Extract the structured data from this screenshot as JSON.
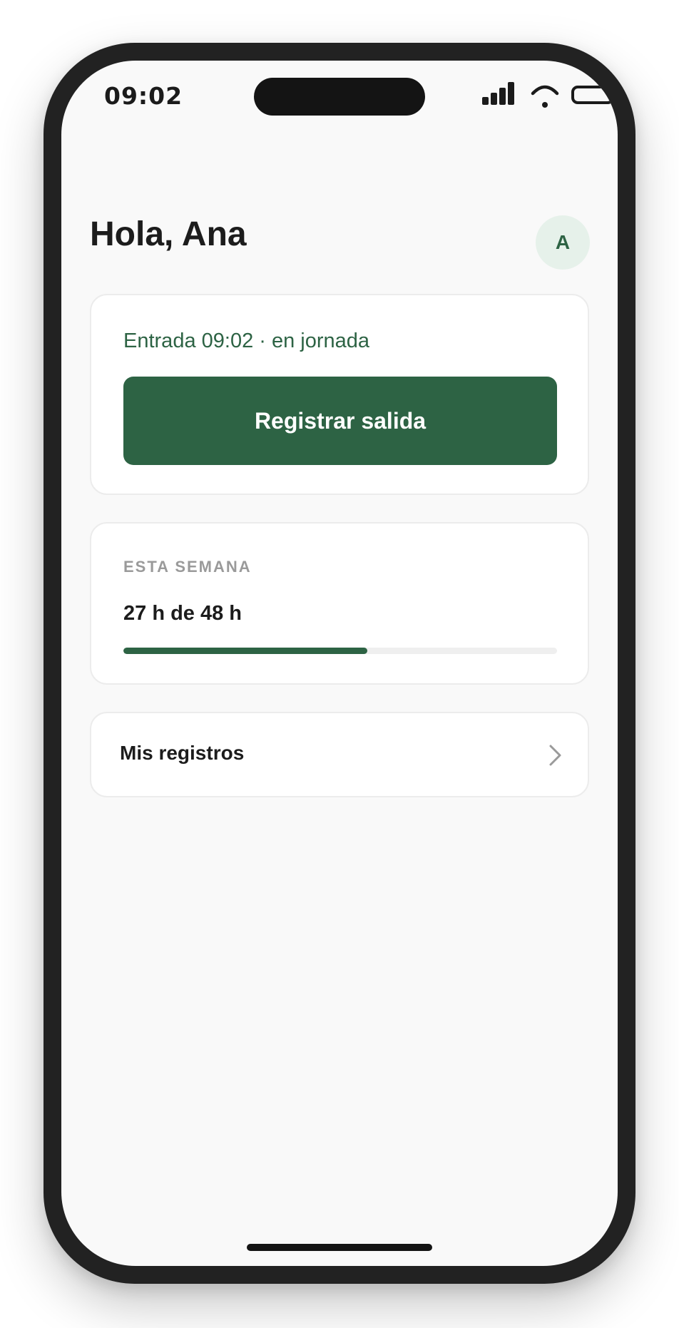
{
  "status_bar": {
    "time": "09:02",
    "icons": [
      "signal-icon",
      "wifi-icon",
      "battery-icon"
    ]
  },
  "header": {
    "greeting": "Hola, Ana",
    "avatar_initial": "A"
  },
  "clock_card": {
    "status": "Entrada 09:02 · en jornada",
    "button_label": "Registrar salida"
  },
  "week_card": {
    "label": "ESTA SEMANA",
    "hours_text": "27 h de 48 h",
    "progress_fraction": 0.5625
  },
  "records_card": {
    "label": "Mis registros",
    "icon": "chevron-right-icon"
  },
  "colors": {
    "accent": "#2d6344",
    "avatar_bg": "#e6f1ea",
    "screen_bg": "#f9f9f9",
    "card_border": "#ececec",
    "muted_text": "#9a9a9a",
    "primary_text": "#1c1c1c"
  }
}
